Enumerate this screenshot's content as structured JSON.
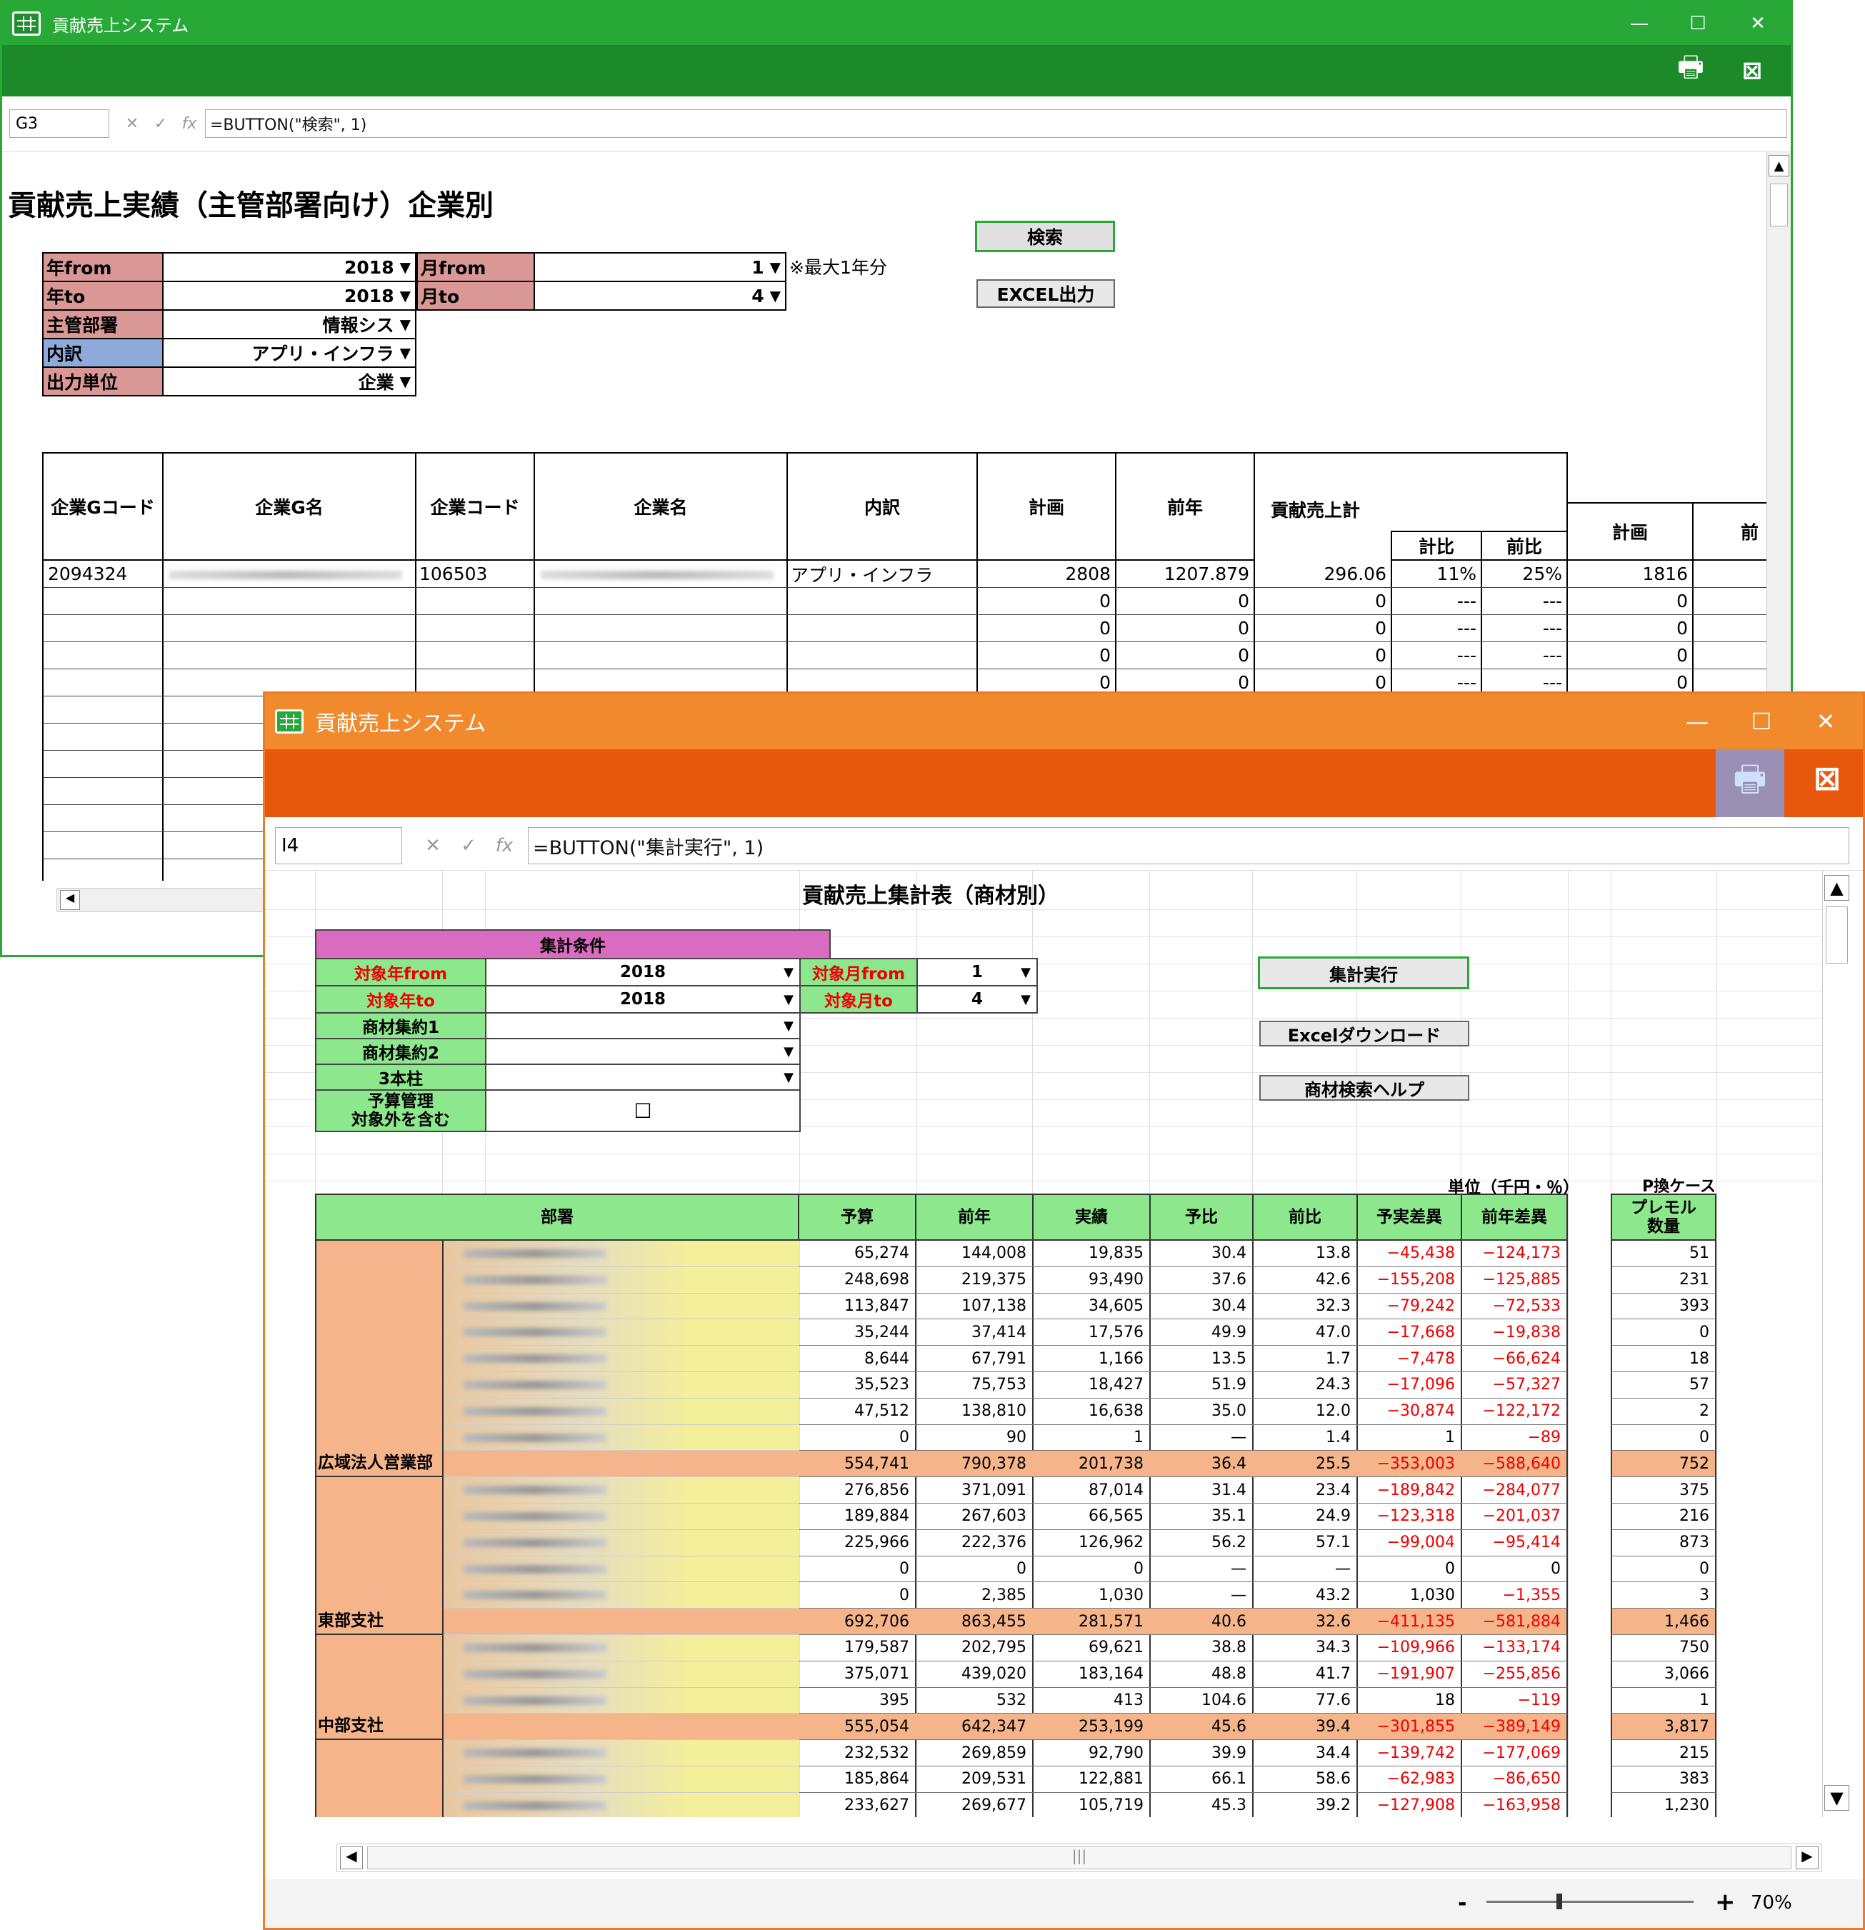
{
  "back_window": {
    "title": "貢献売上システム",
    "cell_ref": "G3",
    "formula": "=BUTTON(\"検索\", 1)",
    "heading": "貢献売上実績（主管部署向け）企業別",
    "note": "※最大1年分",
    "buttons": {
      "search": "検索",
      "excel": "EXCEL出力"
    },
    "filters": [
      {
        "label": "年from",
        "value": "2018"
      },
      {
        "label": "年to",
        "value": "2018"
      },
      {
        "label": "主管部署",
        "value": "情報シス"
      },
      {
        "label": "内訳",
        "value": "アプリ・インフラ"
      },
      {
        "label": "出力単位",
        "value": "企業"
      }
    ],
    "month_filters": [
      {
        "label": "月from",
        "value": "1"
      },
      {
        "label": "月to",
        "value": "4"
      }
    ],
    "columns": [
      "企業Gコード",
      "企業G名",
      "企業コード",
      "企業名",
      "内訳",
      "計画",
      "前年",
      "貢献売上計",
      "計比",
      "前比",
      "計画",
      "前"
    ],
    "rows": [
      {
        "gcode": "2094324",
        "code": "106503",
        "breakdown": "アプリ・インフラ",
        "plan": "2808",
        "prev": "1207.879",
        "total": "296.06",
        "plan_ratio": "11%",
        "prev_ratio": "25%",
        "plan2": "1816"
      },
      {
        "gcode": "",
        "code": "",
        "breakdown": "",
        "plan": "0",
        "prev": "0",
        "total": "0",
        "plan_ratio": "---",
        "prev_ratio": "---",
        "plan2": "0"
      },
      {
        "gcode": "",
        "code": "",
        "breakdown": "",
        "plan": "0",
        "prev": "0",
        "total": "0",
        "plan_ratio": "---",
        "prev_ratio": "---",
        "plan2": "0"
      },
      {
        "gcode": "",
        "code": "",
        "breakdown": "",
        "plan": "0",
        "prev": "0",
        "total": "0",
        "plan_ratio": "---",
        "prev_ratio": "---",
        "plan2": "0"
      },
      {
        "gcode": "",
        "code": "",
        "breakdown": "",
        "plan": "0",
        "prev": "0",
        "total": "0",
        "plan_ratio": "---",
        "prev_ratio": "---",
        "plan2": "0"
      }
    ]
  },
  "front_window": {
    "title": "貢献売上システム",
    "cell_ref": "I4",
    "formula": "=BUTTON(\"集計実行\", 1)",
    "heading": "貢献売上集計表（商材別）",
    "cond_title": "集計条件",
    "conds": [
      {
        "label": "対象年from",
        "value": "2018"
      },
      {
        "label": "対象年to",
        "value": "2018"
      },
      {
        "label": "商材集約1",
        "value": ""
      },
      {
        "label": "商材集約2",
        "value": ""
      },
      {
        "label": "3本柱",
        "value": ""
      },
      {
        "label": "予算管理\n対象外を含む",
        "value": "☐"
      }
    ],
    "month_conds": [
      {
        "label": "対象月from",
        "value": "1"
      },
      {
        "label": "対象月to",
        "value": "4"
      }
    ],
    "buttons": {
      "run": "集計実行",
      "excel": "Excelダウンロード",
      "help": "商材検索ヘルプ"
    },
    "unit_note": "単位（千円・％）",
    "pcase_note": "P換ケース",
    "col_headers": [
      "部署",
      "予算",
      "前年",
      "実績",
      "予比",
      "前比",
      "予実差異",
      "前年差異"
    ],
    "extra_header": "プレモル\n数量",
    "rows": [
      {
        "v": [
          "65,274",
          "144,008",
          "19,835",
          "30.4",
          "13.8",
          "−45,438",
          "−124,173"
        ],
        "q": "51",
        "sub": false
      },
      {
        "v": [
          "248,698",
          "219,375",
          "93,490",
          "37.6",
          "42.6",
          "−155,208",
          "−125,885"
        ],
        "q": "231",
        "sub": false
      },
      {
        "v": [
          "113,847",
          "107,138",
          "34,605",
          "30.4",
          "32.3",
          "−79,242",
          "−72,533"
        ],
        "q": "393",
        "sub": false
      },
      {
        "v": [
          "35,244",
          "37,414",
          "17,576",
          "49.9",
          "47.0",
          "−17,668",
          "−19,838"
        ],
        "q": "0",
        "sub": false
      },
      {
        "v": [
          "8,644",
          "67,791",
          "1,166",
          "13.5",
          "1.7",
          "−7,478",
          "−66,624"
        ],
        "q": "18",
        "sub": false
      },
      {
        "v": [
          "35,523",
          "75,753",
          "18,427",
          "51.9",
          "24.3",
          "−17,096",
          "−57,327"
        ],
        "q": "57",
        "sub": false
      },
      {
        "v": [
          "47,512",
          "138,810",
          "16,638",
          "35.0",
          "12.0",
          "−30,874",
          "−122,172"
        ],
        "q": "2",
        "sub": false
      },
      {
        "v": [
          "0",
          "90",
          "1",
          "—",
          "1.4",
          "1",
          "−89"
        ],
        "q": "0",
        "sub": false
      },
      {
        "v": [
          "554,741",
          "790,378",
          "201,738",
          "36.4",
          "25.5",
          "−353,003",
          "−588,640"
        ],
        "q": "752",
        "sub": true
      },
      {
        "v": [
          "276,856",
          "371,091",
          "87,014",
          "31.4",
          "23.4",
          "−189,842",
          "−284,077"
        ],
        "q": "375",
        "sub": false
      },
      {
        "v": [
          "189,884",
          "267,603",
          "66,565",
          "35.1",
          "24.9",
          "−123,318",
          "−201,037"
        ],
        "q": "216",
        "sub": false
      },
      {
        "v": [
          "225,966",
          "222,376",
          "126,962",
          "56.2",
          "57.1",
          "−99,004",
          "−95,414"
        ],
        "q": "873",
        "sub": false
      },
      {
        "v": [
          "0",
          "0",
          "0",
          "—",
          "—",
          "0",
          "0"
        ],
        "q": "0",
        "sub": false
      },
      {
        "v": [
          "0",
          "2,385",
          "1,030",
          "—",
          "43.2",
          "1,030",
          "−1,355"
        ],
        "q": "3",
        "sub": false
      },
      {
        "v": [
          "692,706",
          "863,455",
          "281,571",
          "40.6",
          "32.6",
          "−411,135",
          "−581,884"
        ],
        "q": "1,466",
        "sub": true
      },
      {
        "v": [
          "179,587",
          "202,795",
          "69,621",
          "38.8",
          "34.3",
          "−109,966",
          "−133,174"
        ],
        "q": "750",
        "sub": false
      },
      {
        "v": [
          "375,071",
          "439,020",
          "183,164",
          "48.8",
          "41.7",
          "−191,907",
          "−255,856"
        ],
        "q": "3,066",
        "sub": false
      },
      {
        "v": [
          "395",
          "532",
          "413",
          "104.6",
          "77.6",
          "18",
          "−119"
        ],
        "q": "1",
        "sub": false
      },
      {
        "v": [
          "555,054",
          "642,347",
          "253,199",
          "45.6",
          "39.4",
          "−301,855",
          "−389,149"
        ],
        "q": "3,817",
        "sub": true
      },
      {
        "v": [
          "232,532",
          "269,859",
          "92,790",
          "39.9",
          "34.4",
          "−139,742",
          "−177,069"
        ],
        "q": "215",
        "sub": false
      },
      {
        "v": [
          "185,864",
          "209,531",
          "122,881",
          "66.1",
          "58.6",
          "−62,983",
          "−86,650"
        ],
        "q": "383",
        "sub": false
      },
      {
        "v": [
          "233,627",
          "269,677",
          "105,719",
          "45.3",
          "39.2",
          "−127,908",
          "−163,958"
        ],
        "q": "1,230",
        "sub": false
      }
    ],
    "departments": [
      {
        "name": "広域法人営業部"
      },
      {
        "name": "東部支社"
      },
      {
        "name": "中部支社"
      }
    ],
    "zoom": "70%"
  }
}
